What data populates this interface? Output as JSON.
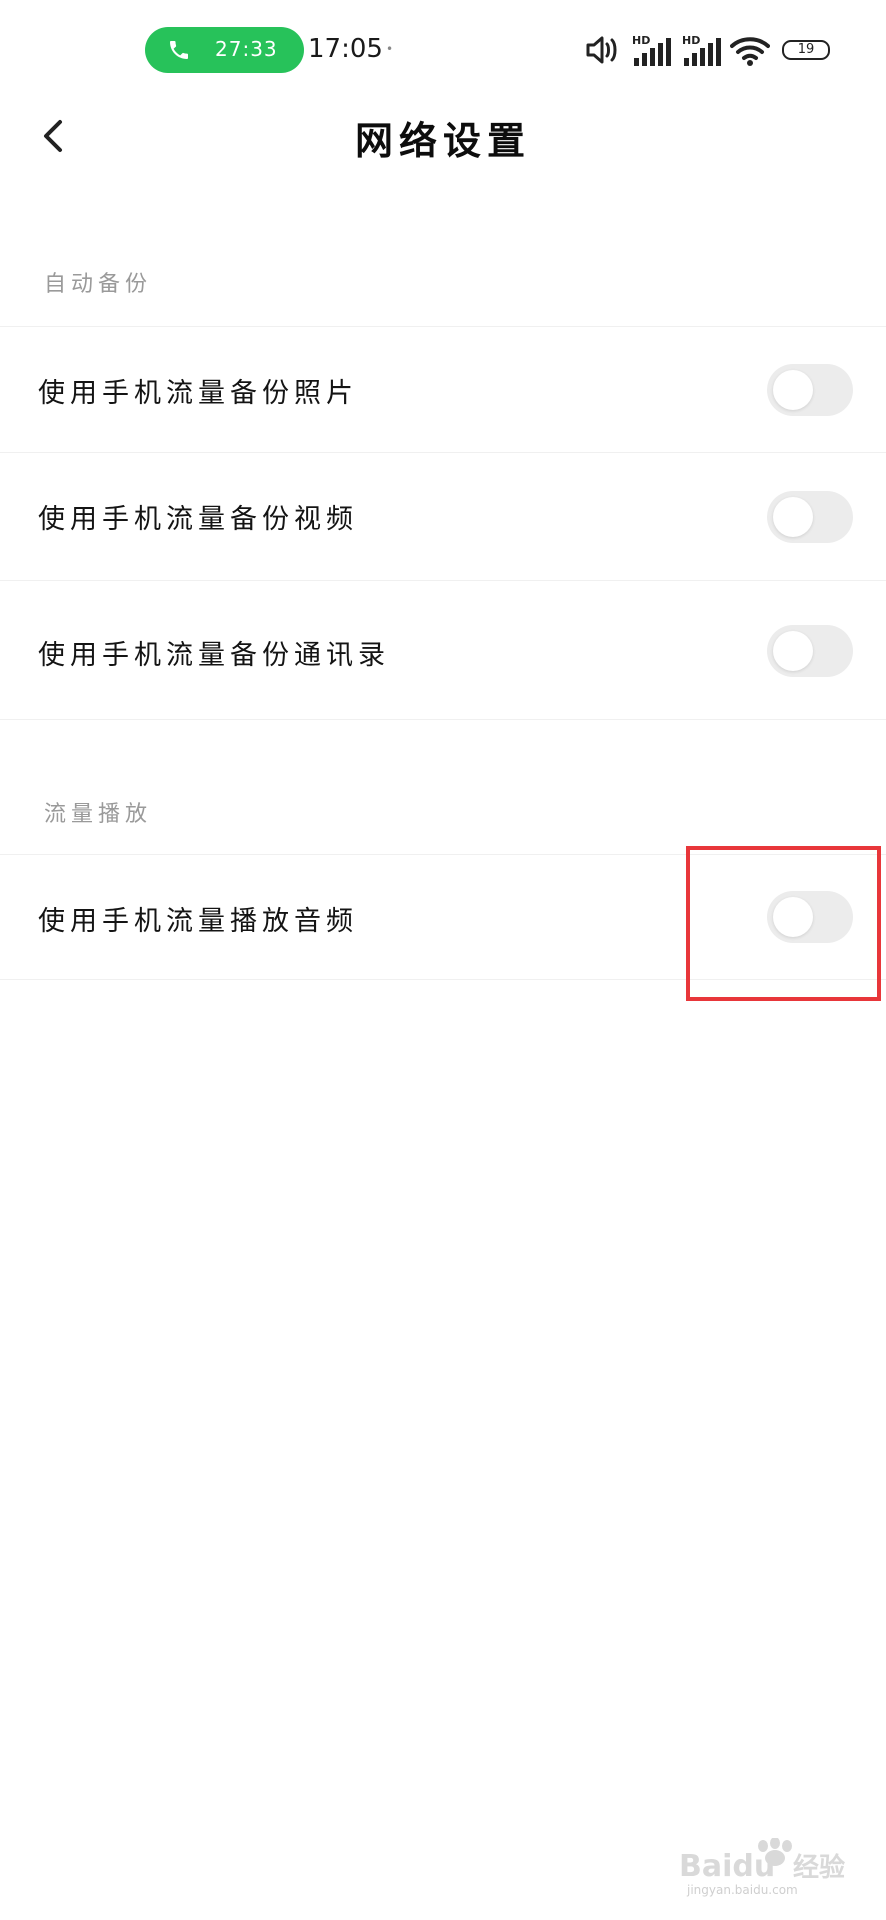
{
  "status_bar": {
    "call_duration": "27:33",
    "time": "17:05",
    "battery_level": "19",
    "network_badge": "HD",
    "call_pill_color": "#27c25a"
  },
  "header": {
    "title": "网络设置"
  },
  "sections": [
    {
      "label": "自动备份",
      "rows": [
        {
          "label": "使用手机流量备份照片",
          "enabled": false
        },
        {
          "label": "使用手机流量备份视频",
          "enabled": false
        },
        {
          "label": "使用手机流量备份通讯录",
          "enabled": false
        }
      ]
    },
    {
      "label": "流量播放",
      "rows": [
        {
          "label": "使用手机流量播放音频",
          "enabled": false
        }
      ]
    }
  ],
  "watermark": {
    "brand": "Baidu",
    "suffix": "经验",
    "url": "jingyan.baidu.com"
  },
  "colors": {
    "highlight_border": "#e8363a",
    "toggle_off_track": "#ececec"
  }
}
